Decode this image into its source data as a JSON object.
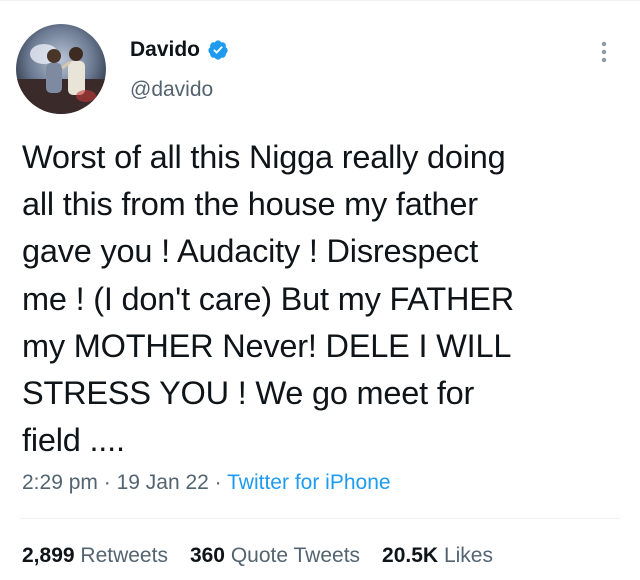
{
  "author": {
    "display_name": "Davido",
    "handle": "@davido",
    "verified": true,
    "avatar_icon": "user-avatar-photo",
    "verified_icon": "verified-badge-icon"
  },
  "tweet": {
    "text": "Worst of all this Nigga really doing\nall this from the house my father\ngave you ! Audacity ! Disrespect\nme ! (I don't care) But my FATHER\nmy MOTHER Never! DELE I WILL\nSTRESS YOU ! We go meet for\nfield ....",
    "time": "2:29 pm",
    "separator": "·",
    "date": "19 Jan 22",
    "source": "Twitter for iPhone"
  },
  "stats": {
    "retweets": {
      "count": "2,899",
      "label": "Retweets"
    },
    "quote_tweets": {
      "count": "360",
      "label": "Quote Tweets"
    },
    "likes": {
      "count": "20.5K",
      "label": "Likes"
    }
  },
  "icons": {
    "more": "more-vertical-icon"
  },
  "colors": {
    "text": "#0f1419",
    "secondary": "#536471",
    "accent": "#1d9bf0",
    "divider": "#eff3f4"
  }
}
